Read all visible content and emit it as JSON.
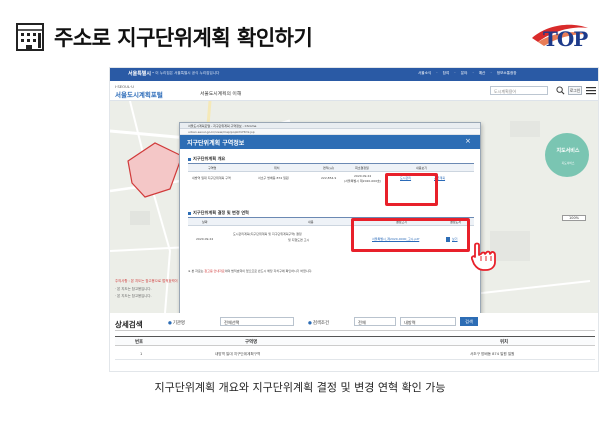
{
  "slide": {
    "title": "주소로 지구단위계획 확인하기",
    "logo_text": "TOP",
    "caption": "지구단위계획 개요와 지구단위계획 결정 및 변경 연혁 확인 가능"
  },
  "browser": {
    "gov_bar": {
      "logo": "서울특별시",
      "notice": "• 이 누리집은 서울특별시 공식 누리집입니다",
      "links": "서울소식 · 참여 · 분야 · 예산 · 정보소통광장"
    },
    "site": {
      "seoul_label": "I·SEOUL·U",
      "name": "서울도시계획포털",
      "nav": "서울도시계획의 이해",
      "search_placeholder": "도시계획용어",
      "login_label": "로그인"
    }
  },
  "map": {
    "notes": [
      "주의사항 : 본 지도는 참고용으로 법적효력이 없습니다.",
      "· 본 지도는 참고용입니다.",
      "· 본 지도는 참고용입니다."
    ],
    "service_button": {
      "label": "지도서비스",
      "sub": "지도서비스"
    },
    "zoom_label": "100%"
  },
  "popup": {
    "window_title": "서울도시계획포털 - 지구단위계획 구역정보 - Chrome",
    "url": "urban.seoul.go.kr/view/map/popInfoHtml.jsp",
    "header_title": "지구단위계획 구역정보",
    "overview": {
      "title": "지구단위계획 개요",
      "columns": [
        "구역명",
        "위치",
        "면적(㎡)",
        "최초결정일",
        "내용보기"
      ],
      "row": {
        "name": "내방역 일대 지구단위계획 구역",
        "location": "서초구 방배동 874 일원",
        "area": "222,854.9",
        "first_date": "2020.09.24",
        "gazette": "(서울특별시 제2020-000호)",
        "view_links": [
          "도시관리",
          "공급계획"
        ]
      }
    },
    "history": {
      "title": "지구단위계획 결정 및 변경 연혁",
      "columns": [
        "날짜",
        "내용",
        "결정고시",
        "결정도서"
      ],
      "row": {
        "date": "2020.09.24",
        "content_line1": "도시관리계획(지구단위계획 및 지구단위계획구역) 결정",
        "content_line2": "및 지형도면 고시",
        "gazette_link": "서울특별시_제2020-0000_고시.pdf",
        "doc_label": "보기"
      }
    },
    "notice_prefix": "※ 본 자료는 ",
    "notice_highlight": "참고용 안내자료",
    "notice_suffix": "이며 법적효력이 없으므로 반드시 해당 자치구에 확인하시기 바랍니다."
  },
  "search": {
    "title": "상세검색",
    "org_label": "기관명",
    "org_value": "전체선택",
    "cond_label": "검색조건",
    "cond_value": "전체",
    "keyword": "내방역",
    "button_label": "검색"
  },
  "results": {
    "columns": [
      "번호",
      "구역명",
      "위치"
    ],
    "rows": [
      {
        "no": "1",
        "name": "내방역 일대 지구단위계획구역",
        "location": "서초구 방배동 874 일원 일원"
      }
    ]
  },
  "colors": {
    "accent_blue": "#2d6db5",
    "highlight_red": "#e8202a",
    "gov_bar": "#2a5aa5"
  }
}
